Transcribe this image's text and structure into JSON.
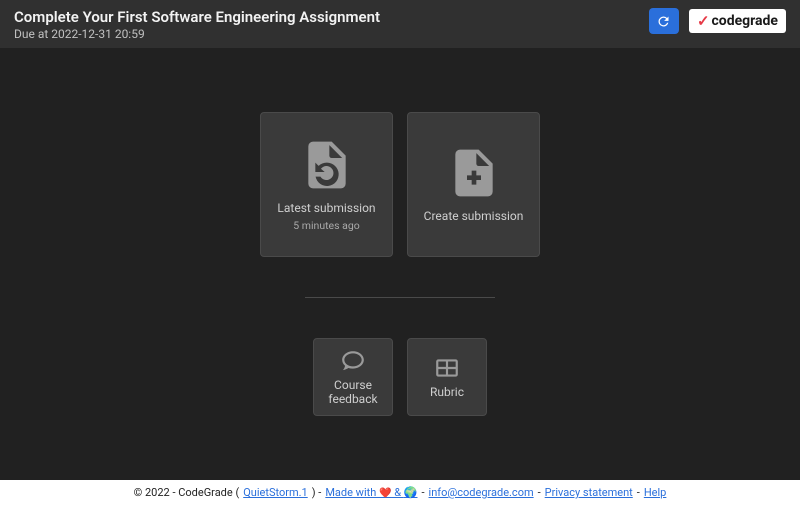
{
  "header": {
    "title": "Complete Your First Software Engineering Assignment",
    "due": "Due at 2022-12-31 20:59",
    "brand_prefix": "✓",
    "brand_name": "codegrade"
  },
  "cards": {
    "latest": {
      "label": "Latest submission",
      "sublabel": "5 minutes ago"
    },
    "create": {
      "label": "Create submission"
    },
    "feedback": {
      "label": "Course feedback"
    },
    "rubric": {
      "label": "Rubric"
    }
  },
  "footer": {
    "copyright": "© 2022 - CodeGrade (",
    "version": "QuietStorm.1",
    "close_paren": ") - ",
    "made_with_pre": "Made with ",
    "heart": "❤️",
    "amp": " & ",
    "earth": "🌍",
    "sep": " - ",
    "email": "info@codegrade.com",
    "privacy": "Privacy statement",
    "help": "Help"
  }
}
